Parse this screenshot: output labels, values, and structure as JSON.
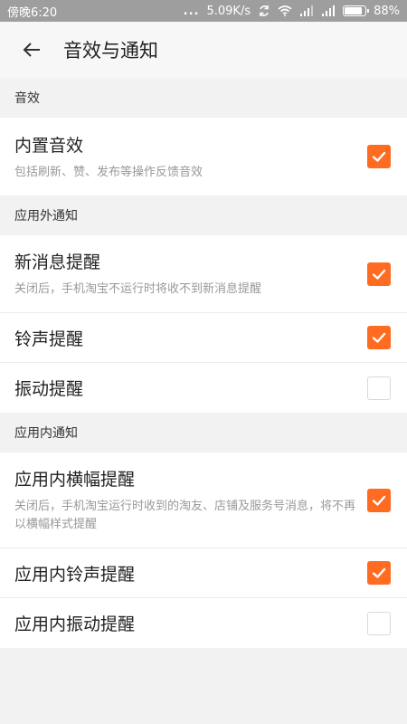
{
  "status_bar": {
    "carrier_time": "傍晚6:20",
    "dots": "...",
    "speed": "5.09K/s",
    "battery": "88%",
    "battery_level": 0.88
  },
  "app_bar": {
    "title": "音效与通知",
    "back_icon": "arrow-left-icon"
  },
  "sections": [
    {
      "header": "音效",
      "items": [
        {
          "title": "内置音效",
          "desc": "包括刷新、赞、发布等操作反馈音效",
          "checked": true
        }
      ]
    },
    {
      "header": "应用外通知",
      "items": [
        {
          "title": "新消息提醒",
          "desc": "关闭后，手机淘宝不运行时将收不到新消息提醒",
          "checked": true
        },
        {
          "title": "铃声提醒",
          "checked": true
        },
        {
          "title": "振动提醒",
          "checked": false
        }
      ]
    },
    {
      "header": "应用内通知",
      "items": [
        {
          "title": "应用内横幅提醒",
          "desc": "关闭后，手机淘宝运行时收到的淘友、店铺及服务号消息，将不再以横幅样式提醒",
          "checked": true
        },
        {
          "title": "应用内铃声提醒",
          "checked": true
        },
        {
          "title": "应用内振动提醒",
          "checked": false
        }
      ]
    }
  ],
  "colors": {
    "accent": "#ff6b21",
    "status_bar": "#9e9e9e",
    "background": "#f2f2f2"
  }
}
